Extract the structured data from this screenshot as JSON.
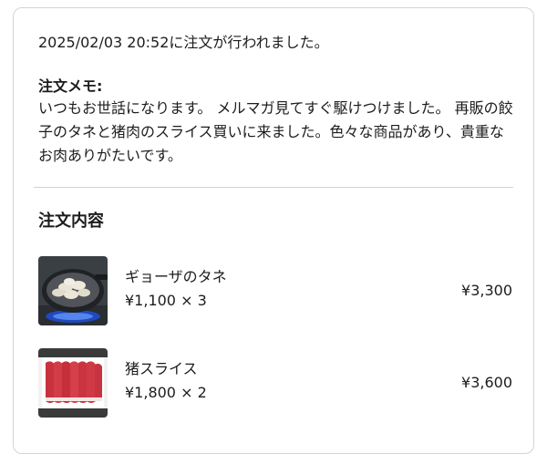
{
  "order": {
    "placed_text": "2025/02/03 20:52に注文が行われました。"
  },
  "memo": {
    "heading": "注文メモ:",
    "body": "いつもお世話になります。 メルマガ見てすぐ駆けつけました。 再販の餃子のタネと猪肉のスライス買いに来ました。色々な商品があり、貴重なお肉ありがたいです。"
  },
  "contents": {
    "title": "注文内容",
    "items": [
      {
        "name": "ギョーザのタネ",
        "qty": "¥1,100 × 3",
        "total": "¥3,300",
        "image": "gyoza-in-pan-image"
      },
      {
        "name": "猪スライス",
        "qty": "¥1,800 × 2",
        "total": "¥3,600",
        "image": "sliced-boar-meat-image"
      }
    ]
  }
}
